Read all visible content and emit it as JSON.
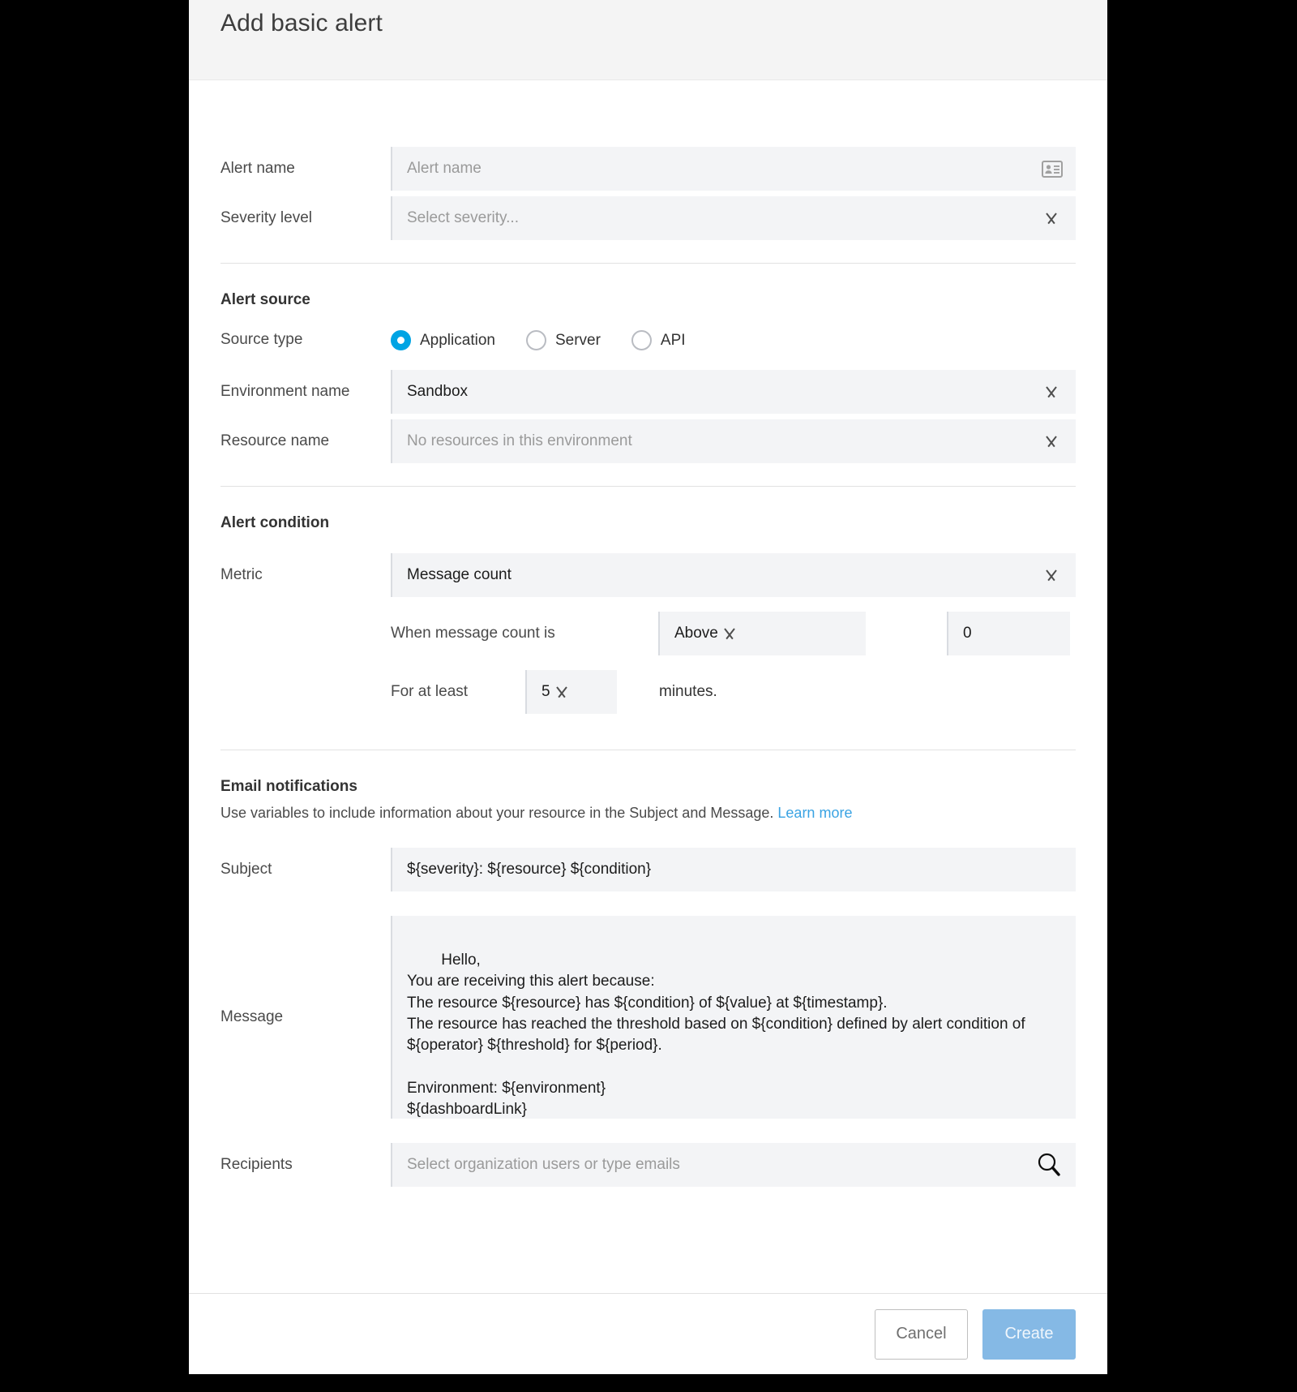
{
  "dialog": {
    "title": "Add basic alert"
  },
  "fields": {
    "alert_name": {
      "label": "Alert name",
      "placeholder": "Alert name",
      "value": "",
      "icon": "contact-card-icon"
    },
    "severity_level": {
      "label": "Severity level",
      "placeholder": "Select severity...",
      "value": "",
      "icon": "chevron-down-icon"
    }
  },
  "alert_source": {
    "heading": "Alert source",
    "source_type": {
      "label": "Source type",
      "options": [
        {
          "label": "Application",
          "selected": true
        },
        {
          "label": "Server",
          "selected": false
        },
        {
          "label": "API",
          "selected": false
        }
      ]
    },
    "environment_name": {
      "label": "Environment name",
      "value": "Sandbox",
      "icon": "chevron-down-icon"
    },
    "resource_name": {
      "label": "Resource name",
      "placeholder": "No resources in this environment",
      "value": "",
      "icon": "chevron-down-icon"
    }
  },
  "alert_condition": {
    "heading": "Alert condition",
    "metric": {
      "label": "Metric",
      "value": "Message count",
      "icon": "chevron-down-icon"
    },
    "when_text": "When message count is",
    "operator": {
      "value": "Above",
      "icon": "chevron-down-icon"
    },
    "threshold": {
      "value": "0"
    },
    "for_at_least_text": "For at least",
    "period": {
      "value": "5",
      "icon": "chevron-down-icon"
    },
    "minutes_text": "minutes."
  },
  "email_notifications": {
    "heading": "Email notifications",
    "description": "Use variables to include information about your resource in the Subject and Message.",
    "learn_more_label": "Learn more",
    "subject": {
      "label": "Subject",
      "value": "${severity}: ${resource} ${condition}"
    },
    "message": {
      "label": "Message",
      "value": "Hello,\nYou are receiving this alert because:\nThe resource ${resource} has ${condition} of ${value} at ${timestamp}.\nThe resource has reached the threshold based on ${condition} defined by alert condition of ${operator} ${threshold} for ${period}.\n\nEnvironment: ${environment}\n${dashboardLink}\n${alertLink}"
    },
    "recipients": {
      "label": "Recipients",
      "placeholder": "Select organization users or type emails",
      "value": "",
      "icon": "search-icon"
    }
  },
  "footer": {
    "cancel_label": "Cancel",
    "create_label": "Create"
  },
  "colors": {
    "accent": "#00a4e4",
    "link": "#3aa3e3",
    "primary_button": "#85b9e5",
    "field_background": "#f3f4f6",
    "header_background": "#f4f4f4"
  }
}
